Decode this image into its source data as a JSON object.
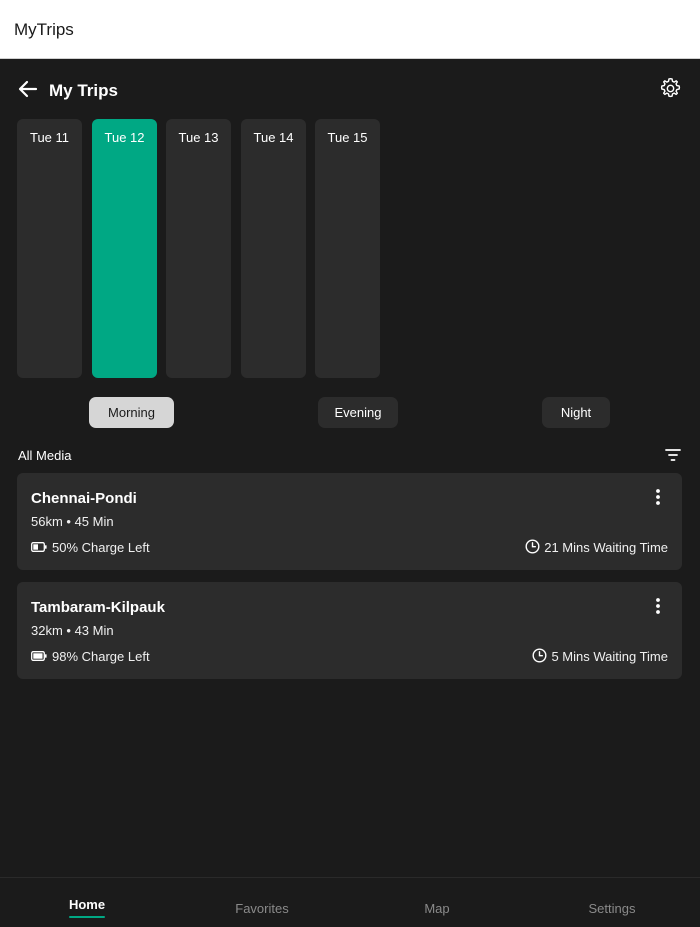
{
  "window": {
    "title": "MyTrips"
  },
  "header": {
    "title": "My Trips",
    "back_icon": "arrow-left-icon",
    "settings_icon": "gear-icon"
  },
  "days": [
    {
      "label": "Tue 11",
      "selected": false
    },
    {
      "label": "Tue 12",
      "selected": true
    },
    {
      "label": "Tue 13",
      "selected": false
    },
    {
      "label": "Tue 14",
      "selected": false
    },
    {
      "label": "Tue 15",
      "selected": false
    }
  ],
  "time_slots": [
    {
      "label": "Morning",
      "selected": true
    },
    {
      "label": "Evening",
      "selected": false
    },
    {
      "label": "Night",
      "selected": false
    }
  ],
  "media": {
    "label": "All Media",
    "filter_icon": "filter-icon"
  },
  "trips": [
    {
      "name": "Chennai-Pondi",
      "meta": "56km • 45 Min",
      "charge": "50% Charge Left",
      "charge_level": 0.5,
      "wait": "21 Mins Waiting Time"
    },
    {
      "name": "Tambaram-Kilpauk",
      "meta": "32km • 43 Min",
      "charge": "98% Charge Left",
      "charge_level": 0.98,
      "wait": "5 Mins Waiting Time"
    }
  ],
  "bottom_nav": [
    {
      "label": "Home",
      "active": true
    },
    {
      "label": "Favorites",
      "active": false
    },
    {
      "label": "Map",
      "active": false
    },
    {
      "label": "Settings",
      "active": false
    }
  ],
  "colors": {
    "accent": "#00a884",
    "background": "#1b1b1b",
    "card": "#2c2c2c",
    "selected_slot": "#d6d6d6"
  }
}
